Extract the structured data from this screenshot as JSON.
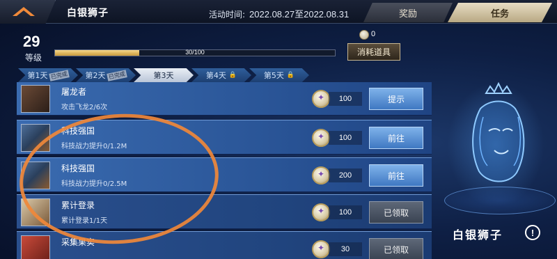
{
  "header": {
    "title": "白银狮子",
    "event_time_label": "活动时间:",
    "event_time_value": "2022.08.27至2022.08.31",
    "tabs": [
      {
        "label": "奖励",
        "active": false
      },
      {
        "label": "任务",
        "active": true
      }
    ]
  },
  "level": {
    "value": "29",
    "label": "等级",
    "progress_text": "30/100",
    "progress_fraction": 0.3
  },
  "currency": {
    "count": "0",
    "consume_button": "消耗道具"
  },
  "days": [
    {
      "label": "第1天",
      "state": "done",
      "stamp": "已完成"
    },
    {
      "label": "第2天",
      "state": "done",
      "stamp": "已完成"
    },
    {
      "label": "第3天",
      "state": "active"
    },
    {
      "label": "第4天",
      "state": "locked"
    },
    {
      "label": "第5天",
      "state": "locked"
    }
  ],
  "tasks": [
    {
      "name": "屠龙者",
      "desc": "攻击飞龙2/6次",
      "reward": "100",
      "button": "提示",
      "claimed": false
    },
    {
      "name": "科技强国",
      "desc": "科技战力提升0/1.2M",
      "reward": "100",
      "button": "前往",
      "claimed": false
    },
    {
      "name": "科技强国",
      "desc": "科技战力提升0/2.5M",
      "reward": "200",
      "button": "前往",
      "claimed": false
    },
    {
      "name": "累计登录",
      "desc": "累计登录1/1天",
      "reward": "100",
      "button": "已领取",
      "claimed": true
    },
    {
      "name": "采集果实",
      "desc": "",
      "reward": "30",
      "button": "已领取",
      "claimed": true
    }
  ],
  "emblem": {
    "name": "白银狮子",
    "info": "!"
  },
  "colors": {
    "accent": "#3f78c2",
    "highlight_circle": "#f0883a",
    "progress_fill": "#c99a3b"
  }
}
